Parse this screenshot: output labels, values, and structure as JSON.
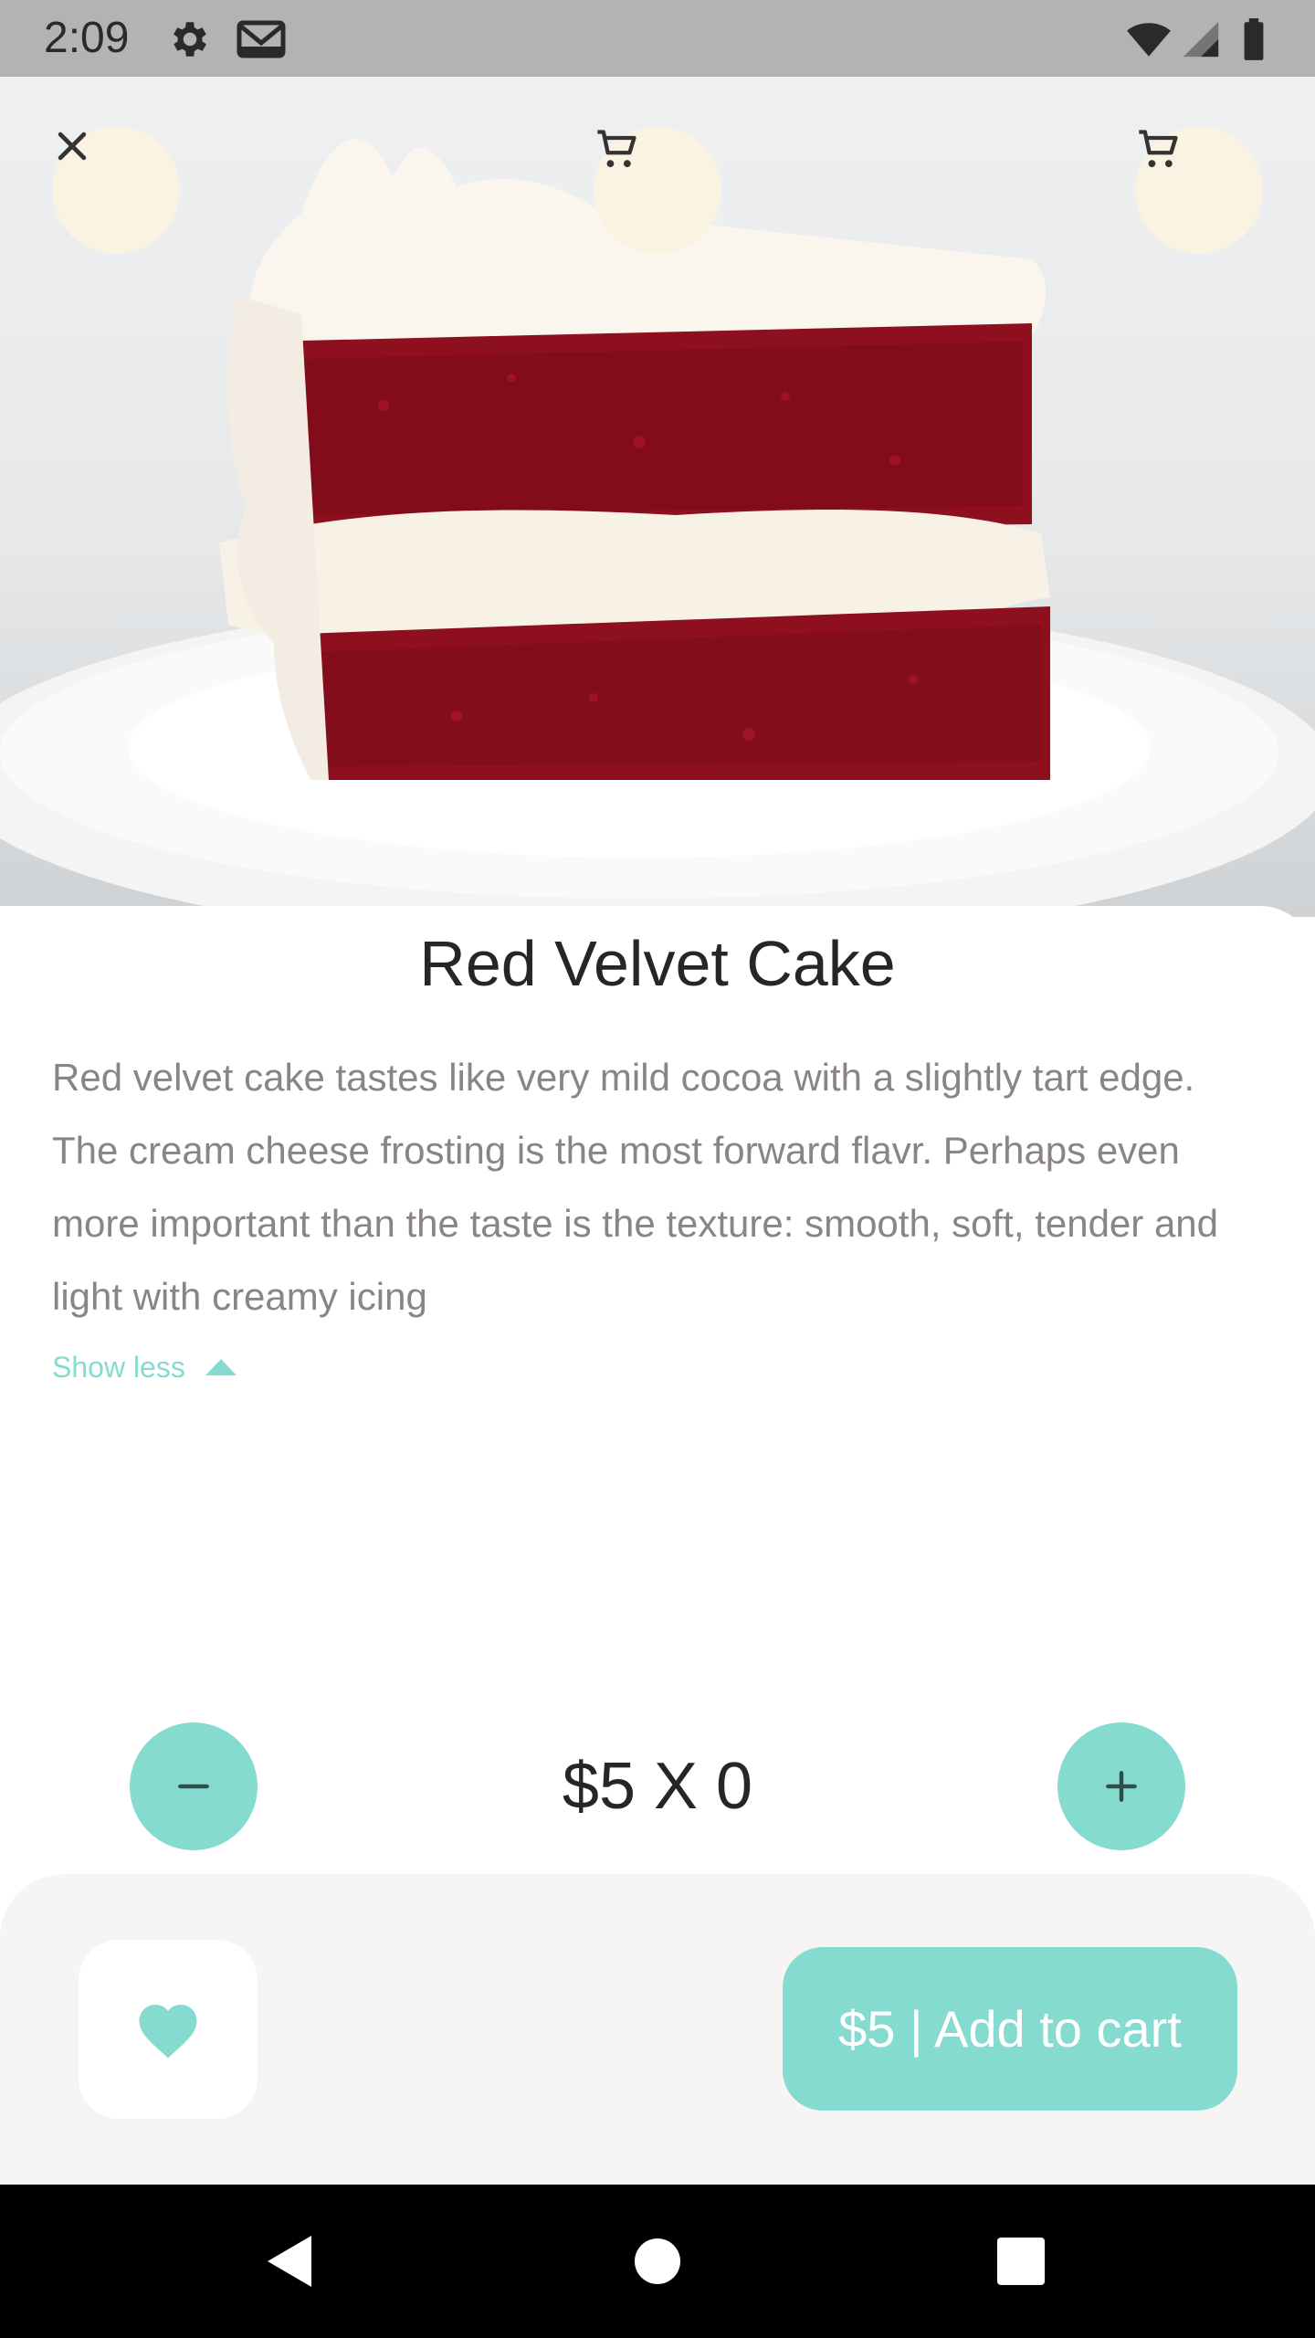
{
  "status_bar": {
    "time": "2:09",
    "left_icons": [
      "settings-icon",
      "gmail-icon"
    ],
    "right_icons": [
      "wifi-icon",
      "signal-icon",
      "battery-icon"
    ]
  },
  "header_buttons": {
    "close_icon": "close-icon",
    "cart_icon": "cart-icon"
  },
  "product": {
    "title": "Red Velvet Cake",
    "description": "Red velvet cake tastes like very mild cocoa with a slightly tart edge. The cream cheese frosting is the most forward flavr. Perhaps even more important than the taste is the texture: smooth, soft, tender and light with creamy icing",
    "show_less_label": "Show less"
  },
  "quantity": {
    "label": "$5 X 0",
    "minus_icon": "minus-icon",
    "plus_icon": "plus-icon"
  },
  "bottom_bar": {
    "favorite_icon": "heart-icon",
    "add_to_cart_label": "$5 | Add to cart"
  },
  "nav_bar": {
    "items": [
      "back-icon",
      "home-icon",
      "recents-icon"
    ]
  },
  "colors": {
    "accent": "#86dbd1",
    "round_button_bg": "#fbf3e2",
    "title_text": "#262626",
    "body_text": "#8a8584",
    "panel_bg": "#f6f5f3"
  }
}
